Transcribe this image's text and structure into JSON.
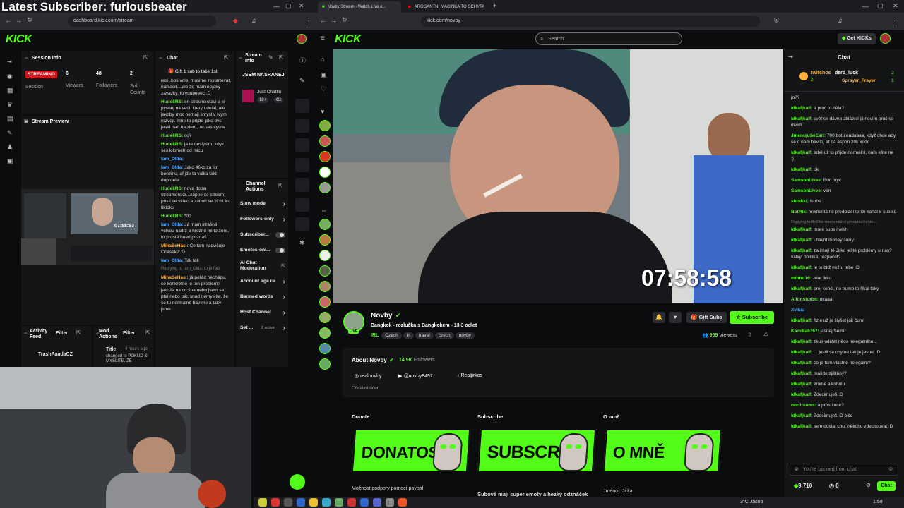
{
  "overlay": {
    "title": "Latest Subscriber: furiousbeater"
  },
  "left_browser": {
    "url": "dashboard.kick.com/stream",
    "session": {
      "title": "Session Info",
      "status": "STREAMING",
      "status_label": "Session",
      "stats": [
        {
          "value": "6",
          "label": "Viewers"
        },
        {
          "value": "48",
          "label": "Followers"
        },
        {
          "value": "2",
          "label": "Sub Counts"
        }
      ]
    },
    "preview": {
      "title": "Stream Preview",
      "clock": "07:58:53"
    },
    "activity": {
      "title": "Activity Feed",
      "filter": "Filter",
      "user": "TrashPandaCZ"
    },
    "mod": {
      "title": "Mod Actions",
      "filter": "Filter",
      "heading": "Title",
      "time": "4 hours ago",
      "text": "changed to POKUD SI MYSLÍTE, ŽE"
    },
    "chat": {
      "title": "Chat",
      "pinned": "Gift 1 sub to take 1st",
      "messages": [
        {
          "user": "",
          "text": "resi..boti vole, musime restartovat, nahlasit....ale ze mam nejaky zavazky, to vuubeeec :D",
          "c": "g"
        },
        {
          "user": "HudekRS:",
          "text": " on strasne stavi a je pysnej na veci, ktery udelal, ale jakoby moc nemaji smysl v tvym rozvoji. mne to prijde jako bys jasal nad hajzlem, ze ses vysral",
          "c": "g"
        },
        {
          "user": "HudekRS:",
          "text": " co?",
          "c": "g"
        },
        {
          "user": "HudekRS:",
          "text": " ja te neslysim, kdyz ses kilometr od micu",
          "c": "g"
        },
        {
          "user": "Iam_Olda:",
          "text": "",
          "c": "b"
        },
        {
          "user": "Iam_Olda:",
          "text": " Jako 46kc za litr benzinu, af jde ta válka fakt doprdele",
          "c": "b"
        },
        {
          "user": "HudekRS:",
          "text": " nova doba streamerska...zapne se stream, pusti se video a zabori se xicht to tiktoku",
          "c": "g"
        },
        {
          "user": "HudekRS:",
          "text": " *do",
          "c": "g"
        },
        {
          "user": "Iam_Olda:",
          "text": " Já mám strašně velkou nádrž a hrozně mi to žere, to prostě hned poznáš",
          "c": "b"
        },
        {
          "user": "MihaSeHasi:",
          "text": " Co tam nacvičuje Ocásek? :D",
          "c": "y"
        },
        {
          "user": "Iam_Olda:",
          "text": " Tak tak",
          "c": "b"
        },
        {
          "user": "MihaSeHasi:",
          "text": " já pořád nechápu, co konkrétně je ten problém? jakože na co špatného jsem se ptal nebo tak, snad nemyslíte, že se tu normálně bavíme a taky jsme",
          "c": "y"
        }
      ],
      "reply": "Replying to Iam_Olda: to je fakt"
    },
    "stream_info": {
      "title": "Stream Info",
      "stream_title": "JSEM NASRANEJ",
      "game": "Just Chattin",
      "rating": "18+",
      "lang": "Cz"
    },
    "channel_actions": {
      "title": "Channel Actions",
      "items": [
        "Slow mode",
        "Followers-only",
        "Subscriber...",
        "Emotes-onl...",
        "AI Chat Moderation",
        "Account age re",
        "Banned words",
        "Host Channel",
        "Set ..."
      ],
      "active_badge": "2 active"
    }
  },
  "right_browser": {
    "tabs": [
      "Novby Stream - Watch Live o...",
      "AROGANTNÍ MACINKA TO SCHYTA..."
    ],
    "url": "kick.com/novby",
    "search_placeholder": "Search",
    "get_kicks": "Get KICKs",
    "video_clock": "07:58:58",
    "streamer": {
      "name": "Novby",
      "live": "LIVE",
      "title": "Bangkok - rozlučka s Bangkokem - 13.3 odlet",
      "category": "IRL",
      "tags": [
        "Czech",
        "irl",
        "travel",
        "czech",
        "novby"
      ],
      "gift_subs": "Gift Subs",
      "subscribe": "Subscribe",
      "viewers": "959",
      "viewers_label": "Viewers"
    },
    "about": {
      "title": "About Novby",
      "followers": "14.9K",
      "followers_label": "Followers",
      "socials": [
        "realnovby",
        "@novby8497",
        "Realjirkos"
      ],
      "official": "Oficiální účet"
    },
    "panels": [
      {
        "title": "Donate",
        "banner": "DONATOSS",
        "caption": "Možnost podpory pomocí paypal"
      },
      {
        "title": "Subscribe",
        "banner": "SUBSCRIBE",
        "caption": "Subové mají super emoty a hezký odznáček"
      },
      {
        "title": "O mně",
        "banner": "O MNĚ",
        "caption": "Jméno : Jirka"
      }
    ]
  },
  "live_chat": {
    "title": "Chat",
    "gifters": [
      {
        "name": "twitchos",
        "count": "2"
      },
      {
        "name": "derd_luck",
        "count": "2"
      },
      {
        "name": "Sprayer_Frayer",
        "count": "1"
      }
    ],
    "messages": [
      {
        "user": "",
        "text": "jo??",
        "c": "g"
      },
      {
        "user": "idkafjkalf:",
        "text": " a proč to děla?",
        "c": "g"
      },
      {
        "user": "idkafjkalf:",
        "text": " svět se dávno zbláznil já nevím proč se divím",
        "c": "g"
      },
      {
        "user": "JmenujuSeEarl:",
        "text": " 700 botu nudaaaa, když chce aby se o nem bavilo, at dá aspon 20k xddd",
        "c": "g"
      },
      {
        "user": "idkafjkalf:",
        "text": " tobě už to přijde normální, nám ešte ne :)",
        "c": "g"
      },
      {
        "user": "idkafjkalf:",
        "text": " ok.",
        "c": "g"
      },
      {
        "user": "SamsonLivee:",
        "text": " Boti pryč",
        "c": "g"
      },
      {
        "user": "SamsonLivee:",
        "text": " ven",
        "c": "g"
      },
      {
        "user": "shrekki:",
        "text": " !subs",
        "c": "g"
      },
      {
        "user": "BotRix:",
        "text": " momentálně předplácí tento kanál 5 subíků",
        "c": "g"
      },
      {
        "user": "idkafjkalf:",
        "text": " more subs i wish",
        "c": "g"
      },
      {
        "user": "idkafjkalf:",
        "text": " i havnt money sorry",
        "c": "g"
      },
      {
        "user": "idkafjkalf:",
        "text": " zajímají tě Jirko ještě problémy u nás? války, politika, rozpočet?",
        "c": "g"
      },
      {
        "user": "idkafjkalf:",
        "text": " je to blíž než u tebe :D",
        "c": "g"
      },
      {
        "user": "minho16:",
        "text": " zdar jirko",
        "c": "g"
      },
      {
        "user": "idkafjkalf:",
        "text": " prej konči, no trump to říkal taky",
        "c": "g"
      },
      {
        "user": "Alfonsturbo:",
        "text": " ukaaa",
        "c": "g"
      },
      {
        "user": "Xvika:",
        "text": " ",
        "c": "b"
      },
      {
        "user": "idkafjkalf:",
        "text": " fízle už je šlyšet jak čumí",
        "c": "g"
      },
      {
        "user": "Kamika6767:",
        "text": " jasnej Semír",
        "c": "g"
      },
      {
        "user": "idkafjkalf:",
        "text": " zkus udělat něco nelegálního...",
        "c": "g"
      },
      {
        "user": "idkafjkalf:",
        "text": " ... jestli se chytne tak je jasnej :D",
        "c": "g"
      },
      {
        "user": "idkafjkalf:",
        "text": " co je tam vlastně nelegální?",
        "c": "g"
      },
      {
        "user": "idkafjkalf:",
        "text": " máš to zjištěný?",
        "c": "g"
      },
      {
        "user": "idkafjkalf:",
        "text": " kromě alkoholu",
        "c": "g"
      },
      {
        "user": "idkafjkalf:",
        "text": " Zdecimuješ :D",
        "c": "g"
      },
      {
        "user": "nordreams:",
        "text": " a prostituce?",
        "c": "g"
      },
      {
        "user": "idkafjkalf:",
        "text": " Zdecimuješ :D pičo",
        "c": "g"
      },
      {
        "user": "idkafjkalf:",
        "text": " sem dostal chuť někoho zdecimovat :D",
        "c": "g"
      }
    ],
    "replying": "Replying to BotRix: momentálně předplácí tento...",
    "banned_placeholder": "You're banned from chat",
    "kicks": "9,710",
    "zero": "0",
    "chat_btn": "Chat"
  },
  "taskbar": {
    "weather": "3°C Jasno",
    "time": "1:59"
  }
}
